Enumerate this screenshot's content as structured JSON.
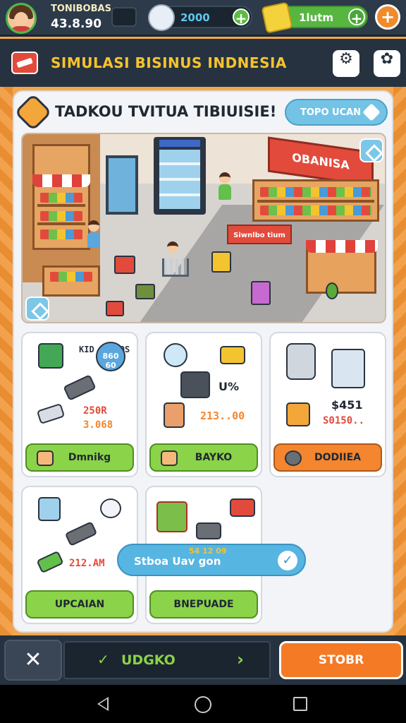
{
  "player": {
    "name": "TONIBOBAS",
    "level": "43.8.90"
  },
  "resources": {
    "coins": "2000",
    "gems": "1lutm"
  },
  "header": {
    "title": "SIMULASI BISINUS INDNESIA"
  },
  "panel": {
    "title": "TADKOU TVITUA TIBIUISIE!",
    "action_label": "TOPO UCAN"
  },
  "scene": {
    "shop_sign": "OBANISA",
    "counter_sign": "Siwnlbo tium"
  },
  "cards": [
    {
      "line1": "KID 10 GOS",
      "line2": "860 60",
      "line3": "250R",
      "line4": "3.068",
      "button": "Dmnikg"
    },
    {
      "line1": "U%",
      "line2": "213..00",
      "button": "BAYKO"
    },
    {
      "line1": "$451",
      "line2": "S0150..",
      "button": "DODIIEA"
    },
    {
      "line1": "212.AM",
      "button": "UPCAIAN"
    },
    {
      "button": "BNEPUADE"
    }
  ],
  "toast": {
    "text": "Stboa Uav gon",
    "small": "54 12 09"
  },
  "bottom": {
    "tool_icon": "✕",
    "chevron": "✓",
    "label": "UDGKO",
    "next": "›",
    "store": "STOBR"
  },
  "icons": {
    "gear": "⚙",
    "shop": "✿",
    "check": "✓",
    "plus": "+"
  },
  "colors": {
    "accent_orange": "#f47a26",
    "accent_green": "#8bd348",
    "title_yellow": "#f6c32e"
  }
}
